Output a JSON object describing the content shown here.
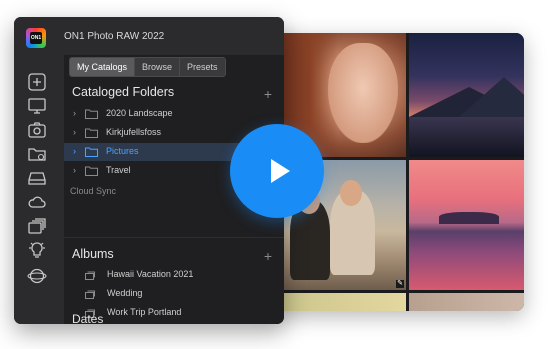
{
  "app": {
    "title": "ON1 Photo RAW 2022",
    "logo_text": "ON1"
  },
  "tabs": [
    "My Catalogs",
    "Browse",
    "Presets"
  ],
  "active_tab": "My Catalogs",
  "cataloged_folders": {
    "title": "Cataloged Folders",
    "add_label": "+",
    "items": [
      {
        "label": "2020 Landscape",
        "selected": false
      },
      {
        "label": "Kirkjufellsfoss",
        "selected": false
      },
      {
        "label": "Pictures",
        "selected": true
      },
      {
        "label": "Travel",
        "selected": false
      }
    ]
  },
  "cloud_sync": "Cloud Sync",
  "albums": {
    "title": "Albums",
    "add_label": "+",
    "items": [
      "Hawaii Vacation 2021",
      "Wedding",
      "Work Trip Portland"
    ]
  },
  "dates_title": "Dates",
  "sidebar_icons": [
    "plus-square-icon",
    "monitor-icon",
    "camera-icon",
    "folder-cloud-icon",
    "drive-icon",
    "cloud-icon",
    "albums-icon",
    "lightbulb-icon",
    "globe-icon"
  ],
  "colors": {
    "accent": "#1a8cf5",
    "selection_text": "#4aa3ff",
    "panel_bg": "#1f1f21",
    "window_bg": "#2b2b2d"
  }
}
